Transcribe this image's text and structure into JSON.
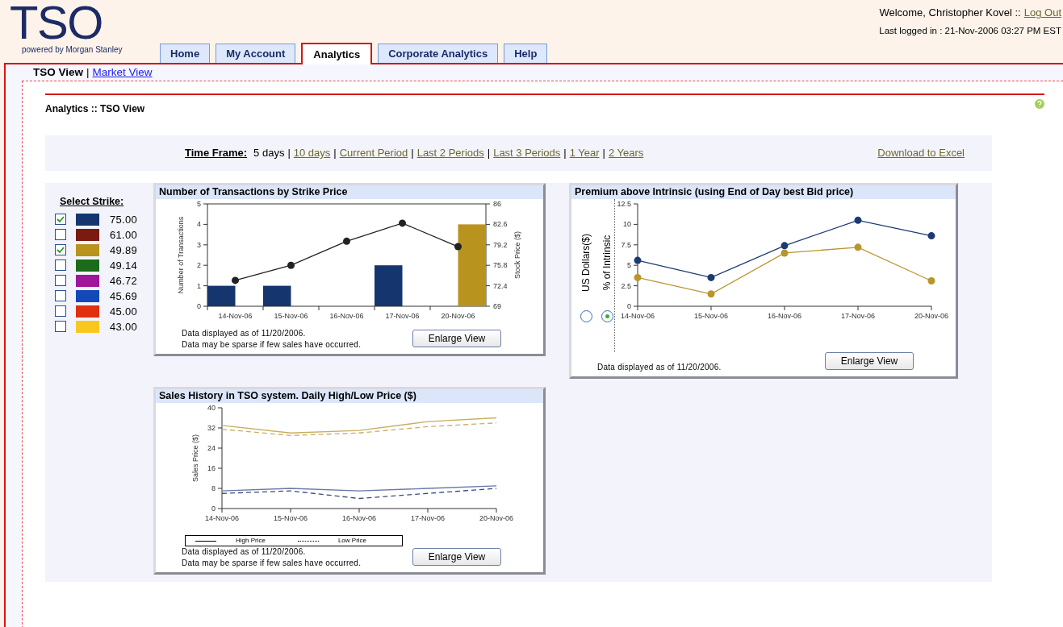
{
  "header": {
    "logo": "TSO",
    "tagline": "powered by Morgan Stanley",
    "welcome": "Welcome, Christopher Kovel ::",
    "logout": "Log Out",
    "last_login": "Last logged in : 21-Nov-2006 03:27 PM EST"
  },
  "tabs": [
    {
      "label": "Home",
      "selected": false
    },
    {
      "label": "My Account",
      "selected": false
    },
    {
      "label": "Analytics",
      "selected": true
    },
    {
      "label": "Corporate Analytics",
      "selected": false
    },
    {
      "label": "Help",
      "selected": false
    }
  ],
  "sub_nav": {
    "separator": "|",
    "items": [
      {
        "label": "TSO View",
        "selected": true
      },
      {
        "label": "Market View",
        "selected": false
      }
    ]
  },
  "page_title": "Analytics :: TSO View",
  "time_frame": {
    "label": "Time Frame:",
    "separator": "|",
    "download": "Download to Excel",
    "options": [
      {
        "label": "5 days",
        "selected": true
      },
      {
        "label": "10 days",
        "selected": false
      },
      {
        "label": "Current Period",
        "selected": false
      },
      {
        "label": "Last 2 Periods",
        "selected": false
      },
      {
        "label": "Last 3 Periods",
        "selected": false
      },
      {
        "label": "1 Year",
        "selected": false
      },
      {
        "label": "2 Years",
        "selected": false
      }
    ]
  },
  "strikes": {
    "title": "Select Strike:",
    "items": [
      {
        "value": "75.00",
        "checked": true,
        "color": "#15356e"
      },
      {
        "value": "61.00",
        "checked": false,
        "color": "#7a1a10"
      },
      {
        "value": "49.89",
        "checked": true,
        "color": "#b8931e"
      },
      {
        "value": "49.14",
        "checked": false,
        "color": "#1a6b1a"
      },
      {
        "value": "46.72",
        "checked": false,
        "color": "#a0159a"
      },
      {
        "value": "45.69",
        "checked": false,
        "color": "#1448b8"
      },
      {
        "value": "45.00",
        "checked": false,
        "color": "#e0300f"
      },
      {
        "value": "43.00",
        "checked": false,
        "color": "#f8c81e"
      }
    ]
  },
  "charts": [
    {
      "kind": "bars_line",
      "title": "Number of Transactions by Strike Price",
      "button": "Enlarge View",
      "footnotes": [
        "Data displayed as of 11/20/2006.",
        "Data may be sparse if few sales have occurred."
      ],
      "chart_data": {
        "type": "bar",
        "ylabel": "Number of Transactions",
        "y2label": "Stock Price ($)",
        "categories": [
          "14-Nov-06",
          "15-Nov-06",
          "16-Nov-06",
          "17-Nov-06",
          "20-Nov-06"
        ],
        "ylim": [
          0,
          5
        ],
        "yticks": [
          0,
          1,
          2,
          3,
          4,
          5
        ],
        "y2lim": [
          69,
          86
        ],
        "y2ticks": [
          69,
          72.4,
          75.8,
          79.2,
          82.6,
          86
        ],
        "series": [
          {
            "color": "#15356e",
            "values": [
              1,
              1,
              0,
              2,
              0
            ]
          },
          {
            "color": "#b8931e",
            "values": [
              0,
              0,
              0,
              0,
              4
            ]
          },
          {
            "color": "#222222",
            "type": "line",
            "axis": "y2",
            "marker": "circle",
            "values": [
              73.3,
              75.8,
              79.8,
              82.8,
              78.9
            ]
          }
        ]
      }
    },
    {
      "kind": "radio_line",
      "title": "Premium above Intrinsic (using End of Day best Bid price)",
      "button": "Enlarge View",
      "footnotes": [
        "Data displayed as of 11/20/2006."
      ],
      "units": [
        {
          "label": "US Dollars($)",
          "selected": false
        },
        {
          "label": "% of Intrinsic",
          "selected": true
        }
      ],
      "chart_data": {
        "type": "line",
        "categories": [
          "14-Nov-06",
          "15-Nov-06",
          "16-Nov-06",
          "17-Nov-06",
          "20-Nov-06"
        ],
        "ylim": [
          0,
          12.5
        ],
        "yticks": [
          0,
          2.5,
          5,
          7.5,
          10,
          12.5
        ],
        "series": [
          {
            "color": "#1c3a72",
            "marker": "circle",
            "values": [
              5.6,
              3.5,
              7.4,
              10.5,
              8.6
            ]
          },
          {
            "color": "#b8962e",
            "marker": "circle",
            "values": [
              3.5,
              1.5,
              6.5,
              7.2,
              3.1
            ]
          }
        ]
      }
    },
    {
      "kind": "legend_line",
      "title": "Sales History in TSO system. Daily High/Low Price ($)",
      "button": "Enlarge View",
      "footnotes": [
        "Data displayed as of 11/20/2006.",
        "Data may be sparse if few sales have occurred."
      ],
      "legend": [
        {
          "label": "High Price",
          "dashed": false
        },
        {
          "label": "Low Price",
          "dashed": true
        }
      ],
      "chart_data": {
        "type": "line",
        "ylabel": "Sales Price ($)",
        "categories": [
          "14-Nov-06",
          "15-Nov-06",
          "16-Nov-06",
          "17-Nov-06",
          "20-Nov-06"
        ],
        "ylim": [
          0,
          40
        ],
        "yticks": [
          0,
          8,
          16,
          24,
          32,
          40
        ],
        "series": [
          {
            "color": "#c8ad60",
            "line_style": "solid",
            "values": [
              33,
              30,
              31,
              34.5,
              36
            ]
          },
          {
            "color": "#c8ad60",
            "line_style": "dashed",
            "values": [
              31.5,
              29,
              30,
              32.5,
              34
            ]
          },
          {
            "color": "#6a78a8",
            "line_style": "solid",
            "values": [
              7,
              8,
              7,
              8,
              9
            ]
          },
          {
            "color": "#3a4a7a",
            "line_style": "dashed",
            "values": [
              6,
              7,
              4,
              6,
              8
            ]
          }
        ]
      }
    }
  ]
}
